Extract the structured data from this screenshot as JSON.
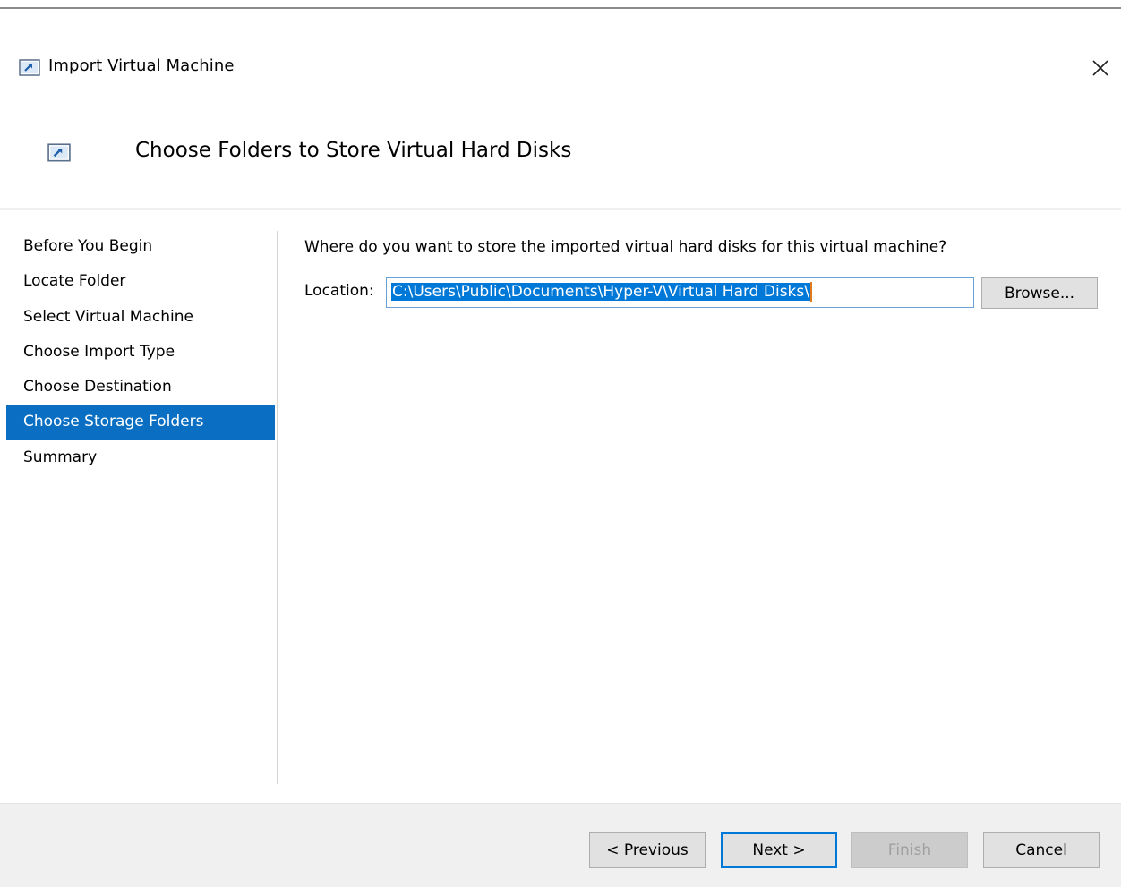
{
  "window": {
    "title": "Import Virtual Machine",
    "close_symbol": "✕",
    "icon": "vm-import-icon"
  },
  "header": {
    "title": "Choose Folders to Store Virtual Hard Disks",
    "icon": "vm-import-icon"
  },
  "sidebar": {
    "items": [
      {
        "label": "Before You Begin"
      },
      {
        "label": "Locate Folder"
      },
      {
        "label": "Select Virtual Machine"
      },
      {
        "label": "Choose Import Type"
      },
      {
        "label": "Choose Destination"
      },
      {
        "label": "Choose Storage Folders",
        "active": true
      },
      {
        "label": "Summary"
      }
    ]
  },
  "main": {
    "question": "Where do you want to store the imported virtual hard disks for this virtual machine?",
    "location_label": "Location:",
    "location_value": "C:\\Users\\Public\\Documents\\Hyper-V\\Virtual Hard Disks\\",
    "browse_label": "Browse..."
  },
  "footer": {
    "previous_label": "< Previous",
    "next_label": "Next >",
    "finish_label": "Finish",
    "cancel_label": "Cancel"
  },
  "colors": {
    "accent": "#0078d7",
    "active_nav": "#0a6fc2",
    "footer_bg": "#f0f0f0"
  }
}
